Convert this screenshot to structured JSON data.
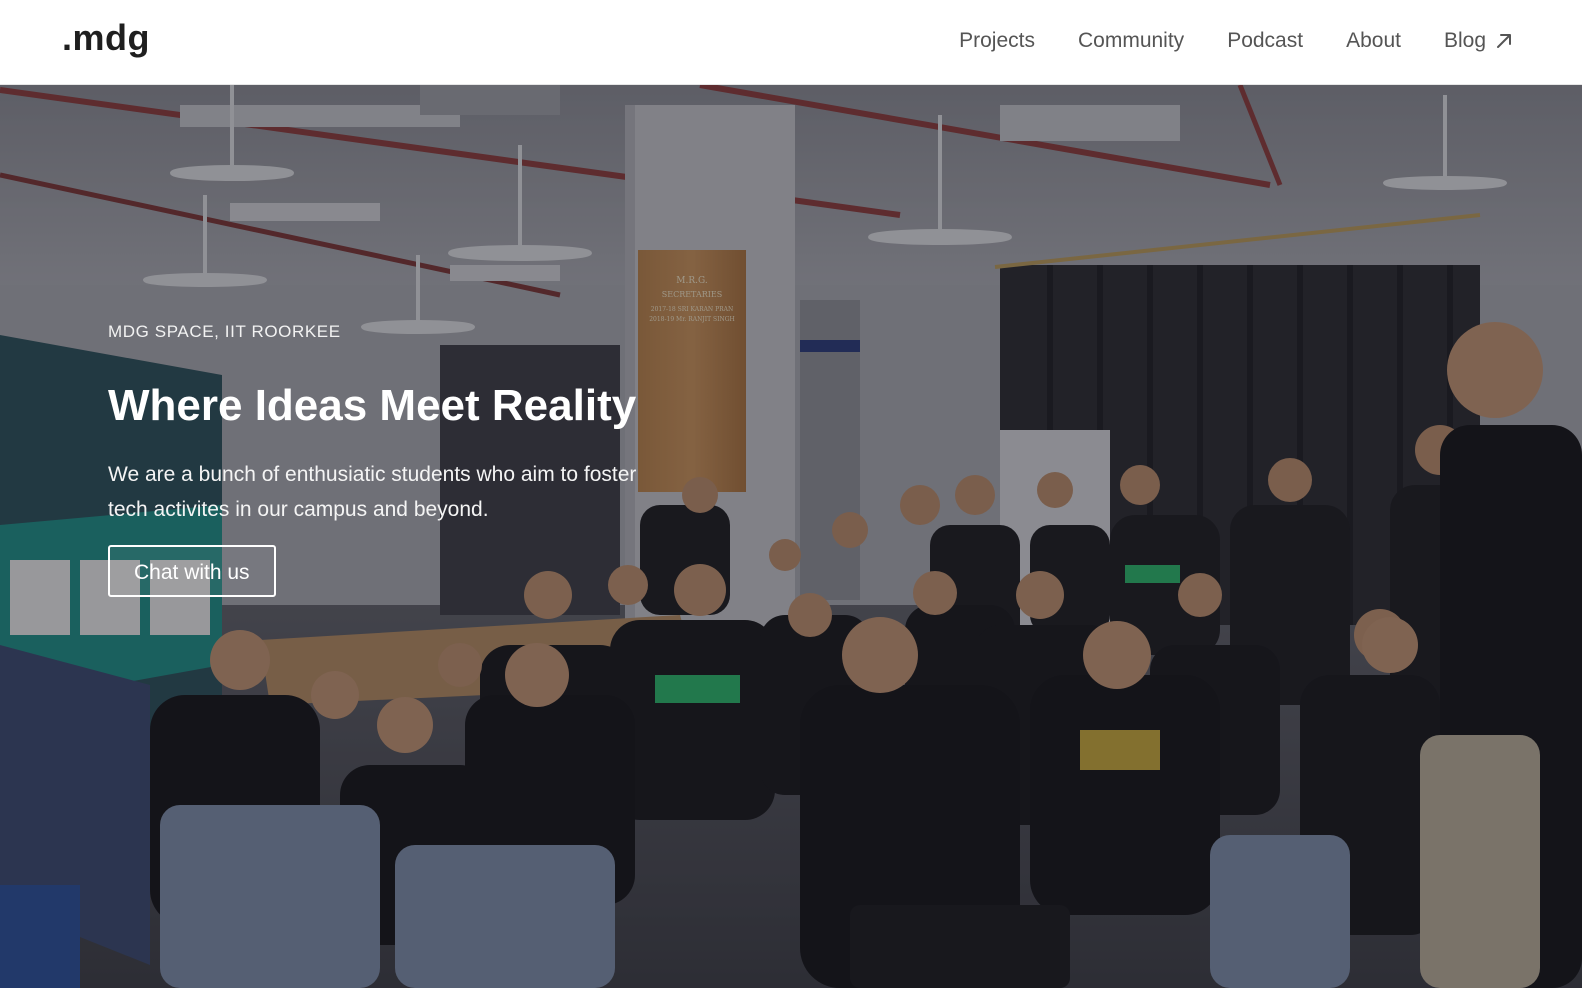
{
  "brand": {
    "logo_text": ".mdg"
  },
  "nav": {
    "items": [
      {
        "label": "Projects"
      },
      {
        "label": "Community"
      },
      {
        "label": "Podcast"
      },
      {
        "label": "About"
      },
      {
        "label": "Blog"
      }
    ],
    "blog_external_icon": "arrow-up-right-icon"
  },
  "hero": {
    "eyebrow": "MDG SPACE, IIT ROORKEE",
    "headline": "Where Ideas Meet Reality",
    "subtext": "We are a bunch of enthusiatic students who aim to foster tech activites in our campus and beyond.",
    "cta_label": "Chat with us",
    "background_image": "group-photo-of-students-in-lab",
    "board": {
      "line1": "M.R.G.",
      "line2": "SECRETARIES",
      "line3": "2017-18  SRI  KARAN PRAN",
      "line4": "2018-19  Mr.  RANJIT SINGH"
    }
  },
  "colors": {
    "nav_text": "#555555",
    "logo": "#1f1f1f",
    "hero_text": "#ffffff"
  }
}
